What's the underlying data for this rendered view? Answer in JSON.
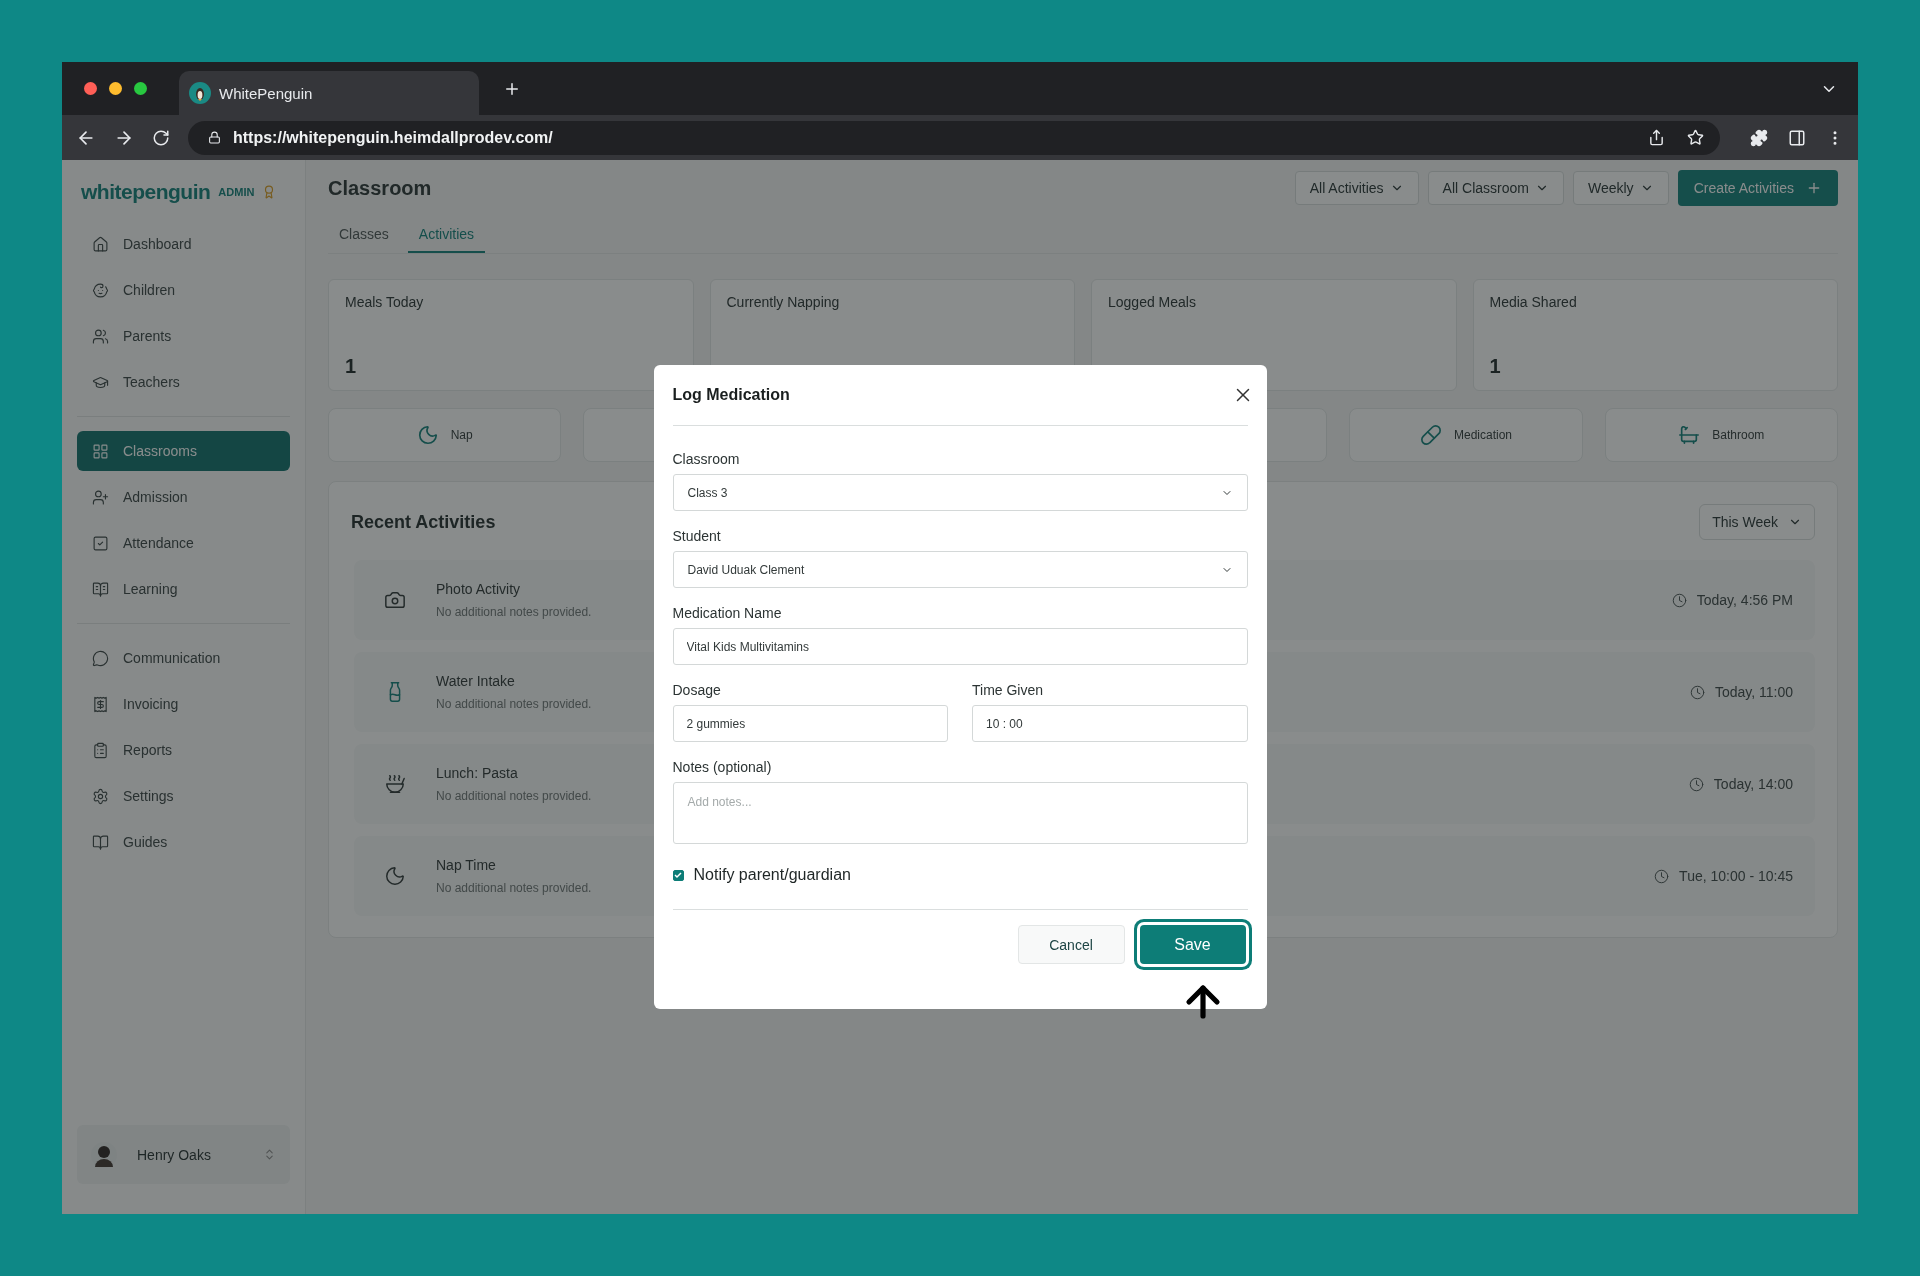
{
  "browser": {
    "tab_title": "WhitePenguin",
    "url": "https://whitepenguin.heimdallprodev.com/"
  },
  "sidebar": {
    "logo": "whitepenguin",
    "badge": "ADMIN",
    "groups": [
      [
        {
          "label": "Dashboard",
          "selected": false
        },
        {
          "label": "Children",
          "selected": false
        },
        {
          "label": "Parents",
          "selected": false
        },
        {
          "label": "Teachers",
          "selected": false
        }
      ],
      [
        {
          "label": "Classrooms",
          "selected": true
        },
        {
          "label": "Admission",
          "selected": false
        },
        {
          "label": "Attendance",
          "selected": false
        },
        {
          "label": "Learning",
          "selected": false
        }
      ],
      [
        {
          "label": "Communication",
          "selected": false
        },
        {
          "label": "Invoicing",
          "selected": false
        },
        {
          "label": "Reports",
          "selected": false
        },
        {
          "label": "Settings",
          "selected": false
        },
        {
          "label": "Guides",
          "selected": false
        }
      ]
    ],
    "user": {
      "name": "Henry Oaks"
    }
  },
  "header": {
    "title": "Classroom",
    "filters": [
      "All Activities",
      "All Classroom",
      "Weekly"
    ],
    "create_button": "Create Activities"
  },
  "tabs": [
    {
      "label": "Classes",
      "selected": false
    },
    {
      "label": "Activities",
      "selected": true
    }
  ],
  "stats": [
    {
      "label": "Meals Today",
      "value": "1"
    },
    {
      "label": "Currently Napping"
    },
    {
      "label": "Logged Meals"
    },
    {
      "label": "Media Shared",
      "value": "1"
    }
  ],
  "activity_buttons": [
    {
      "kind": "nap",
      "label": "Nap"
    },
    {
      "kind": "covered"
    },
    {
      "kind": "hidden"
    },
    {
      "kind": "covered"
    },
    {
      "kind": "medication",
      "label": "Medication"
    },
    {
      "kind": "bathroom",
      "label": "Bathroom"
    }
  ],
  "recent_activities": {
    "title": "Recent Activities",
    "period": "This Week",
    "rows": [
      {
        "kind": "photo",
        "title": "Photo Activity",
        "note": "No additional notes provided.",
        "time": "Today, 4:56 PM"
      },
      {
        "kind": "water",
        "title": "Water Intake",
        "note": "No additional notes provided.",
        "time": "Today, 11:00"
      },
      {
        "kind": "meal",
        "title": "Lunch: Pasta",
        "note": "No additional notes provided.",
        "time": "Today, 14:00"
      },
      {
        "kind": "nap",
        "title": "Nap Time",
        "note": "No additional notes provided.",
        "time": "Tue, 10:00 - 10:45"
      }
    ]
  },
  "modal": {
    "title": "Log Medication",
    "classroom": {
      "label": "Classroom",
      "value": "Class 3"
    },
    "student": {
      "label": "Student",
      "value": "David Uduak Clement"
    },
    "medication_name": {
      "label": "Medication Name",
      "value": "Vital Kids Multivitamins"
    },
    "dosage": {
      "label": "Dosage",
      "value": "2 gummies"
    },
    "time_given": {
      "label": "Time Given",
      "value": "10 : 00"
    },
    "notes": {
      "label": "Notes (optional)",
      "placeholder": "Add notes..."
    },
    "notify": {
      "label": "Notify parent/guardian",
      "checked": true
    },
    "cancel": "Cancel",
    "save": "Save"
  }
}
